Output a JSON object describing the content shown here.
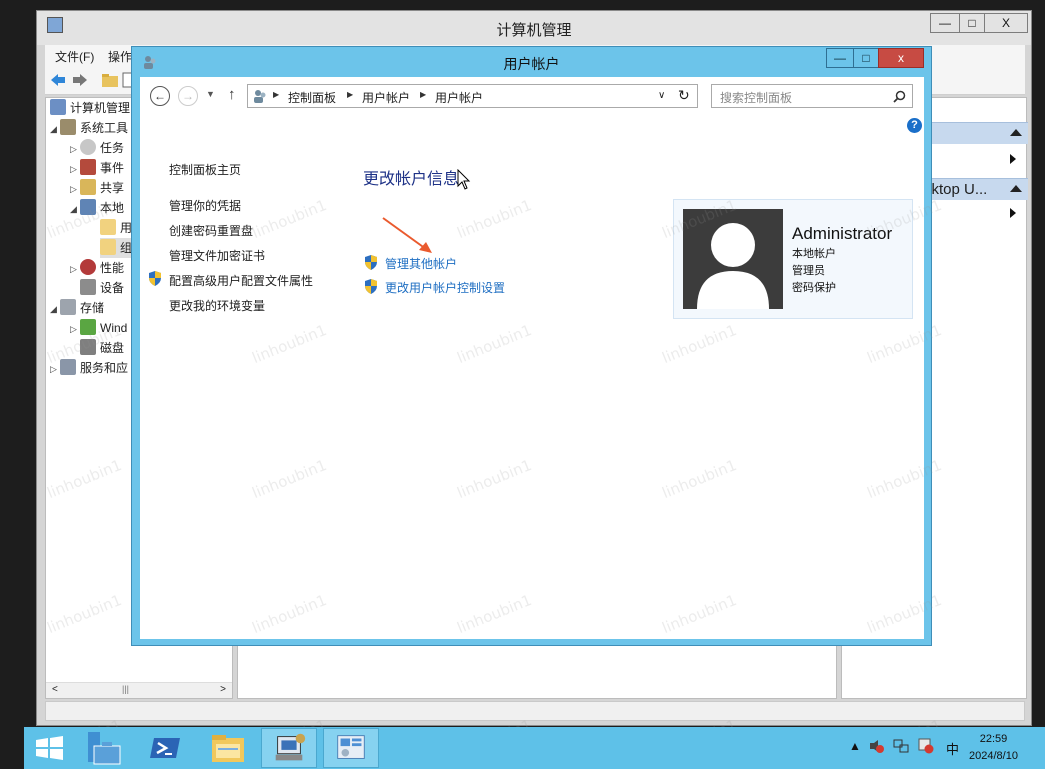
{
  "bg_window": {
    "title": "计算机管理",
    "menu": [
      "文件(F)",
      "操作"
    ],
    "buttons": {
      "minimize": "—",
      "maximize": "□",
      "close": "X"
    },
    "tree": [
      {
        "label": "计算机管理",
        "icon": "computer-icon"
      },
      {
        "label": "系统工具",
        "icon": "tools-icon"
      },
      {
        "label": "任务",
        "icon": "clock-icon"
      },
      {
        "label": "事件",
        "icon": "event-viewer-icon"
      },
      {
        "label": "共享",
        "icon": "shared-folder-icon"
      },
      {
        "label": "本地",
        "icon": "users-icon"
      },
      {
        "label": "用",
        "icon": "folder-icon"
      },
      {
        "label": "组",
        "icon": "folder-icon"
      },
      {
        "label": "性能",
        "icon": "performance-icon"
      },
      {
        "label": "设备",
        "icon": "device-manager-icon"
      },
      {
        "label": "存储",
        "icon": "storage-icon"
      },
      {
        "label": "Wind",
        "icon": "backup-icon"
      },
      {
        "label": "磁盘",
        "icon": "disk-icon"
      },
      {
        "label": "服务和应",
        "icon": "services-icon"
      }
    ],
    "actions_header": "sktop U..."
  },
  "fg_window": {
    "title": "用户帐户",
    "buttons": {
      "minimize": "—",
      "maximize": "□",
      "close": "x"
    },
    "breadcrumb": [
      "控制面板",
      "用户帐户",
      "用户帐户"
    ],
    "search_placeholder": "搜索控制面板",
    "help": "?",
    "left_links": [
      "控制面板主页",
      "管理你的凭据",
      "创建密码重置盘",
      "管理文件加密证书",
      "配置高级用户配置文件属性",
      "更改我的环境变量"
    ],
    "heading": "更改帐户信息",
    "tasks": [
      "管理其他帐户",
      "更改用户帐户控制设置"
    ],
    "account": {
      "name": "Administrator",
      "type": "本地帐户",
      "role": "管理员",
      "protection": "密码保护"
    }
  },
  "watermark": "linhoubin1",
  "taskbar": {
    "apps": [
      "start-icon",
      "server-manager-icon",
      "powershell-icon",
      "file-explorer-icon",
      "computer-management-icon",
      "control-panel-icon"
    ],
    "ime": "中",
    "time": "22:59",
    "date": "2024/8/10"
  },
  "colors": {
    "accent": "#6cc4ea",
    "link": "#1e6ec2",
    "heading": "#1e3287",
    "close": "#c74b43"
  }
}
